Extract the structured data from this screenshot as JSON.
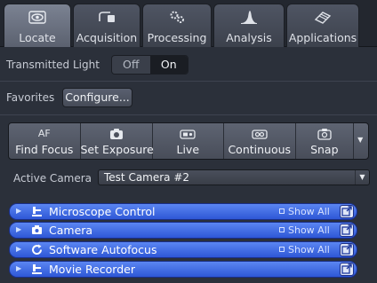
{
  "tabs": [
    {
      "label": "Locate",
      "icon": "eye-icon",
      "active": true
    },
    {
      "label": "Acquisition",
      "icon": "acquisition-icon",
      "active": false
    },
    {
      "label": "Processing",
      "icon": "processing-icon",
      "active": false
    },
    {
      "label": "Analysis",
      "icon": "analysis-icon",
      "active": false
    },
    {
      "label": "Applications",
      "icon": "applications-icon",
      "active": false
    }
  ],
  "transmitted_light": {
    "label": "Transmitted Light",
    "off_label": "Off",
    "on_label": "On",
    "value": "On"
  },
  "favorites": {
    "label": "Favorites",
    "configure_label": "Configure..."
  },
  "actions": [
    {
      "top": "AF",
      "label": "Find Focus",
      "icon": "af-icon"
    },
    {
      "top": "",
      "label": "Set Exposure",
      "icon": "camera-icon"
    },
    {
      "top": "",
      "label": "Live",
      "icon": "video-icon"
    },
    {
      "top": "",
      "label": "Continuous",
      "icon": "continuous-icon"
    },
    {
      "top": "",
      "label": "Snap",
      "icon": "camera-icon"
    }
  ],
  "active_camera": {
    "label": "Active Camera",
    "value": "Test Camera #2"
  },
  "tool_panels": [
    {
      "title": "Microscope Control",
      "icon": "microscope-icon",
      "show_all": "Show All"
    },
    {
      "title": "Camera",
      "icon": "camera-icon",
      "show_all": "Show All"
    },
    {
      "title": "Software Autofocus",
      "icon": "autofocus-icon",
      "show_all": "Show All"
    },
    {
      "title": "Movie Recorder",
      "icon": "movie-recorder-icon",
      "show_all": ""
    }
  ],
  "colors": {
    "background": "#2b303a",
    "panel_blue": "#3b66e0",
    "active_tab": "#6b7282"
  }
}
